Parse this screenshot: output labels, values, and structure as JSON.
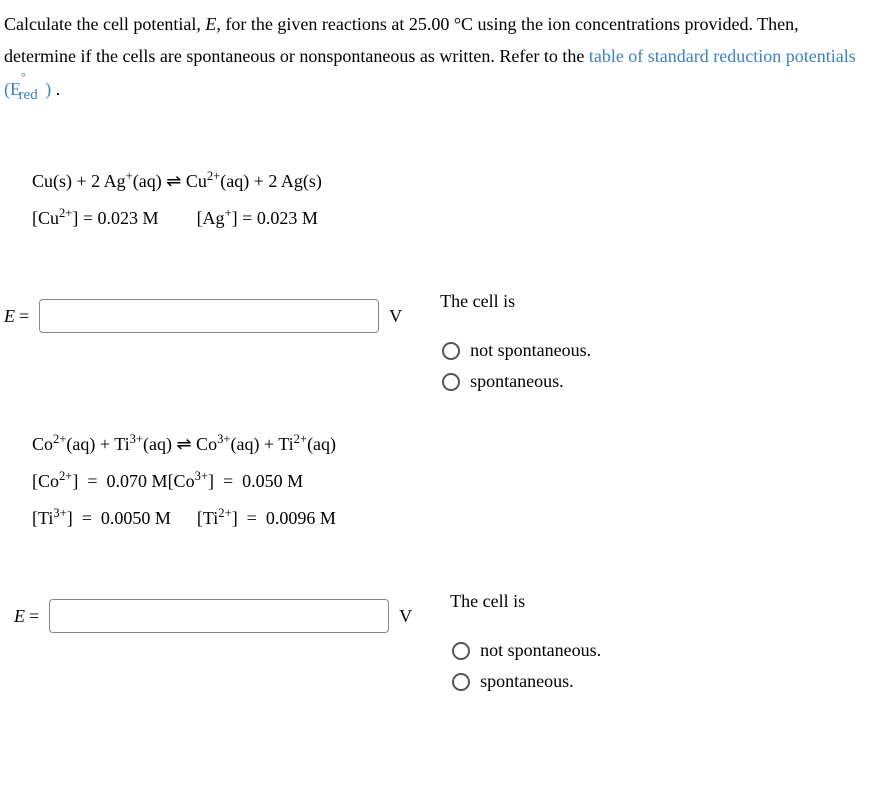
{
  "intro": {
    "part1": "Calculate the cell potential, ",
    "Evar": "E",
    "part2": ", for the given reactions at 25.00 °C using the ion concentrations provided. Then, determine if the cells are spontaneous or nonspontaneous as written. Refer to the ",
    "linkText": "table of standard reduction potentials (E",
    "linkSub": "red",
    "linkSup": "°",
    "linkEnd": ")",
    "part3": " ."
  },
  "q1": {
    "equation_html": "Cu(s) + 2 Ag<sup>+</sup>(aq) &#8652; Cu<sup>2+</sup>(aq) + 2 Ag(s)",
    "conc1_html": "[Cu<sup>2+</sup>] = 0.023 M",
    "conc2_html": "[Ag<sup>+</sup>] = 0.023 M",
    "Elabel": "E",
    "equals": "=",
    "unit": "V",
    "cellIs": "The cell is",
    "opt1": "not spontaneous.",
    "opt2": "spontaneous."
  },
  "q2": {
    "equation_html": "Co<sup>2+</sup>(aq) + Ti<sup>3+</sup>(aq) &#8652; Co<sup>3+</sup>(aq) + Ti<sup>2+</sup>(aq)",
    "conc1_html": "[Co<sup>2+</sup>]&nbsp; =&nbsp; 0.070 M",
    "conc2_html": "[Co<sup>3+</sup>]&nbsp; =&nbsp; 0.050 M",
    "conc3_html": "[Ti<sup>3+</sup>]&nbsp; =&nbsp; 0.0050 M",
    "conc4_html": "[Ti<sup>2+</sup>]&nbsp; =&nbsp; 0.0096 M",
    "Elabel": "E",
    "equals": "=",
    "unit": "V",
    "cellIs": "The cell is",
    "opt1": "not spontaneous.",
    "opt2": "spontaneous."
  }
}
